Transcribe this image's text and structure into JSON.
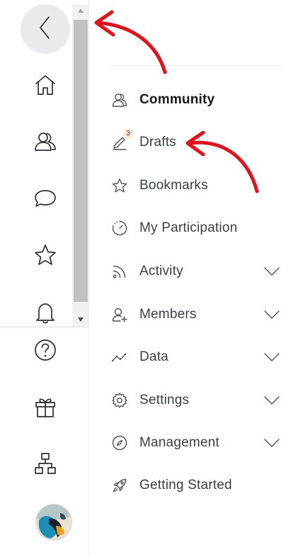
{
  "rail": {
    "items": [
      {
        "name": "home",
        "icon": "home-icon"
      },
      {
        "name": "community",
        "icon": "people-icon"
      },
      {
        "name": "messages",
        "icon": "chat-bubble-icon"
      },
      {
        "name": "favorites",
        "icon": "star-icon"
      },
      {
        "name": "notifications",
        "icon": "bell-icon"
      },
      {
        "name": "help",
        "icon": "help-circle-icon"
      },
      {
        "name": "gifts",
        "icon": "gift-icon"
      },
      {
        "name": "structure",
        "icon": "hierarchy-icon"
      }
    ],
    "back_icon": "chevron-left-icon"
  },
  "menu": {
    "items": [
      {
        "label": "Community",
        "icon": "people-icon",
        "active": true,
        "expandable": false
      },
      {
        "label": "Drafts",
        "icon": "pencil-icon",
        "badge": "3",
        "active": false,
        "expandable": false
      },
      {
        "label": "Bookmarks",
        "icon": "star-icon",
        "active": false,
        "expandable": false
      },
      {
        "label": "My Participation",
        "icon": "gauge-icon",
        "active": false,
        "expandable": false
      },
      {
        "label": "Activity",
        "icon": "rss-icon",
        "active": false,
        "expandable": true
      },
      {
        "label": "Members",
        "icon": "add-member-icon",
        "active": false,
        "expandable": true
      },
      {
        "label": "Data",
        "icon": "trend-line-icon",
        "active": false,
        "expandable": true
      },
      {
        "label": "Settings",
        "icon": "gear-icon",
        "active": false,
        "expandable": true
      },
      {
        "label": "Management",
        "icon": "compass-icon",
        "active": false,
        "expandable": true
      },
      {
        "label": "Getting Started",
        "icon": "rocket-icon",
        "active": false,
        "expandable": false
      }
    ]
  },
  "colors": {
    "annotation_arrow": "#e0121c",
    "back_button_bg": "#e9eaec",
    "scrollbar_thumb": "#c1c1c1",
    "badge_bg": "#fde8d6"
  }
}
